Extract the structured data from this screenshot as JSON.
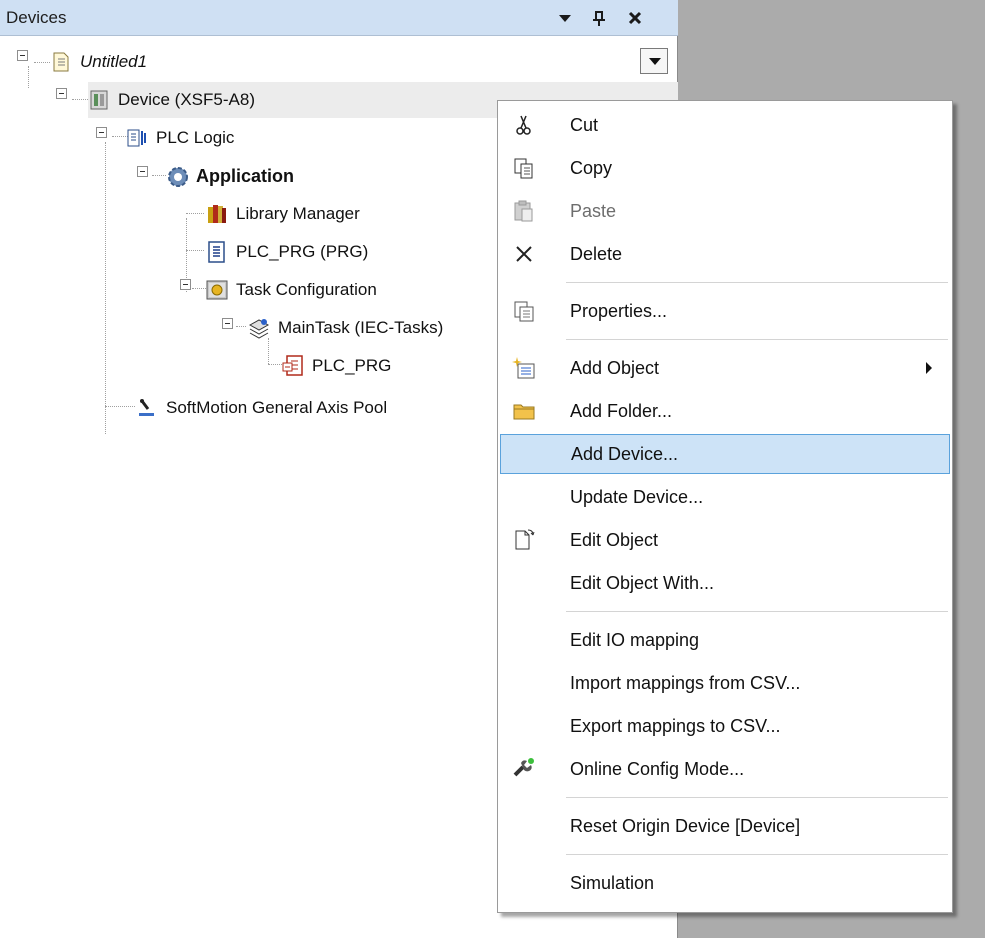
{
  "panel": {
    "title": "Devices",
    "dropdown_icon": "dropdown-arrow-icon",
    "pin_icon": "pin-icon",
    "close_icon": "close-icon"
  },
  "tree": {
    "project": "Untitled1",
    "device": "Device (XSF5-A8)",
    "plc_logic": "PLC Logic",
    "application": "Application",
    "library_manager": "Library Manager",
    "plc_prg_pou": "PLC_PRG (PRG)",
    "task_configuration": "Task Configuration",
    "main_task": "MainTask (IEC-Tasks)",
    "plc_prg_call": "PLC_PRG",
    "axis_pool": "SoftMotion General Axis Pool"
  },
  "menu": {
    "cut": "Cut",
    "copy": "Copy",
    "paste": "Paste",
    "delete": "Delete",
    "properties": "Properties...",
    "add_object": "Add Object",
    "add_folder": "Add Folder...",
    "add_device": "Add Device...",
    "update_device": "Update Device...",
    "edit_object": "Edit Object",
    "edit_object_with": "Edit Object With...",
    "edit_io_mapping": "Edit IO mapping",
    "import_mappings": "Import mappings from CSV...",
    "export_mappings": "Export mappings to CSV...",
    "online_config": "Online Config Mode...",
    "reset_origin": "Reset Origin Device [Device]",
    "simulation": "Simulation"
  },
  "colors": {
    "header_bg": "#cfe0f3",
    "menu_hover_bg": "#cde3f7",
    "menu_hover_border": "#5aa2dc",
    "background": "#ababab"
  }
}
